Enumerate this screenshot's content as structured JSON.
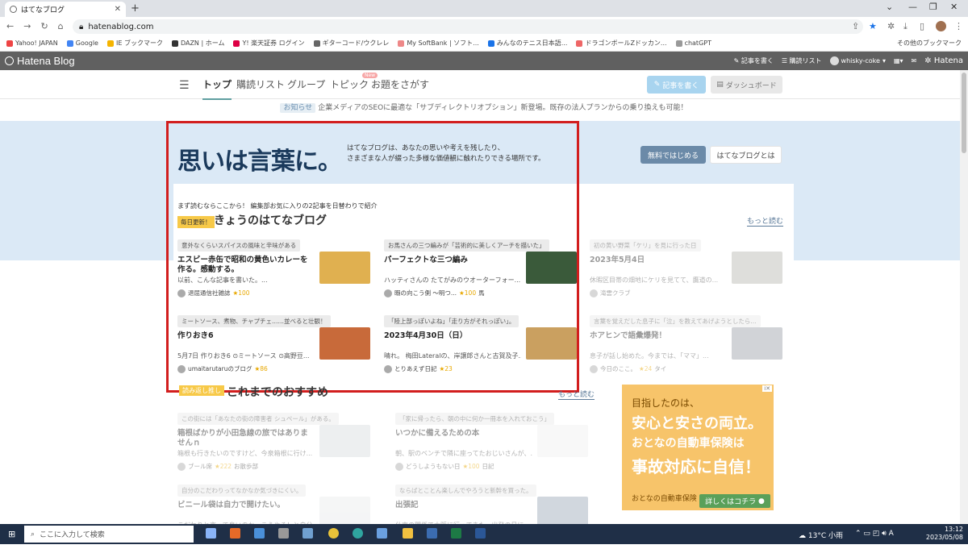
{
  "browser": {
    "tab_title": "はてなブログ",
    "address": "hatenablog.com",
    "other_bookmarks": "その他のブックマーク",
    "bookmarks": [
      "Yahoo! JAPAN",
      "Google",
      "IE ブックマーク",
      "DAZN | ホーム",
      "Y! 楽天証券 ログイン",
      "ギターコード/ウクレレ",
      "My SoftBank | ソフト...",
      "みんなのテニス日本語...",
      "ドラゴンボールZドッカン...",
      "chatGPT"
    ]
  },
  "hatena_bar": {
    "logo": "Hatena Blog",
    "write": "記事を書く",
    "reading": "購読リスト",
    "user": "whisky-coke",
    "brand": "Hatena"
  },
  "nav": {
    "items": [
      "トップ",
      "購読リスト",
      "グループ",
      "トピック",
      "お題をさがす"
    ],
    "new_badge": "New",
    "write_button": "記事を書く",
    "dashboard_button": "ダッシュボード"
  },
  "announcement": {
    "tag": "お知らせ",
    "text": "企業メディアのSEOに最適な「サブディレクトリオプション」新登場。既存の法人プランからの乗り換えも可能！"
  },
  "hero": {
    "title": "思いは言葉に。",
    "desc_line1": "はてなブログは、あなたの思いや考えを残したり、",
    "desc_line2": "さまざまな人が綴った多様な価値観に触れたりできる場所です。",
    "start_button": "無料ではじめる",
    "about_button": "はてなブログとは"
  },
  "daily": {
    "intro": "まず読むならここから！ 編集部お気に入りの2記事を日替わりで紹介",
    "badge": "毎日更新！",
    "title": "きょうのはてなブログ",
    "more": "もっと読む",
    "cards": [
      {
        "tag": "意外なくらいスパイスの風味と辛味がある",
        "title": "エスビー赤缶で昭和の黄色いカレーを作る。感動する。",
        "summary": "以前、こんな記事を書いた。...",
        "author": "退屈通信社雑誌",
        "stars": "★100",
        "star_value": 100
      },
      {
        "tag": "お馬さんの三つ編みが「芸術的に美しくアーチを描いた」",
        "title": "パーフェクトな三つ編み",
        "summary": "ハッティさんの たてがみのウオーターフォー...",
        "author": "暇の向こう側 〜明つ...",
        "stars": "★100",
        "extra": "馬",
        "star_value": 100
      },
      {
        "tag": "初の黄い野菜「ケリ」を見に行った日",
        "title": "2023年5月4日",
        "summary": "休暇区目帯の畑地にケリを見てて、鷹道の...",
        "author": "滝雲クラブ",
        "stars": "",
        "star_value": 0
      },
      {
        "tag": "ミートソース、煮物、チャプチェ……並べると壮観！",
        "title": "作りおき6",
        "summary": "5月7日 作りおき6 ⊙ミートソース ⊙高野豆...",
        "author": "umaitarutaruのブログ",
        "stars": "★86",
        "star_value": 86
      },
      {
        "tag": "「陸上部っぽいよね」「走り方がそれっぽい」。",
        "title": "2023年4月30日（日）",
        "summary": "晴れ。 梅田Lateralの、岸譲郎さんと古賀及子...",
        "author": "とりあえず日記",
        "stars": "★23",
        "star_value": 23
      },
      {
        "tag": "言葉を覚えだした息子に「泣」を教えてあげようとしたら...",
        "title": "ホアヒンで語彙爆発！",
        "summary": "息子が話し始めた。今までは、「ママ」...",
        "author": "今日のここ。",
        "stars": "★24",
        "extra": "タイ",
        "star_value": 24
      }
    ]
  },
  "recommend": {
    "badge": "読み返し推し",
    "title": "これまでのおすすめ",
    "more": "もっと読む",
    "cards": [
      {
        "tag": "この街には「あなたの街の障害者 シュペール」がある。",
        "title": "箱根ばかりが小田急線の旅ではありませんｎ",
        "summary": "箱根も行きたいのですけど、今泉箱根に行け...",
        "author": "ブール席",
        "stars": "★222",
        "extra": "お散歩部",
        "star_value": 222
      },
      {
        "tag": "「家に帰ったら、朝の中に何か一冊本を入れておこう」",
        "title": "いつかに備えるための本",
        "summary": "朝、駅のベンチで隣に座ってたおじいさんが、...",
        "author": "どうしようもない日",
        "stars": "★100",
        "extra": "日記",
        "star_value": 100
      },
      {
        "tag": "自分のこだわりってなかなか気づきにくい。",
        "title": "ビニール袋は自力で開けたい。",
        "summary": "こだわりと言って良いのか、こうやる！と自分...",
        "author": "",
        "stars": "",
        "star_value": 0
      },
      {
        "tag": "ならばとことん楽しんでやろうと新幹を買った。",
        "title": "出張記",
        "summary": "仕事の関係で大阪に行ってきた。出発の日に...",
        "author": "",
        "stars": "",
        "star_value": 0
      }
    ]
  },
  "ad": {
    "line1": "目指したのは、",
    "line2": "安心と安さの両立。",
    "line3": "おとなの自動車保険は",
    "line4": "事故対応に自信！",
    "brand": "おとなの自動車保険",
    "cta": "詳しくはコチラ"
  },
  "taskbar": {
    "search_placeholder": "ここに入力して検索",
    "weather": "13°C 小雨",
    "time": "13:12",
    "date": "2023/05/08"
  },
  "colors": {
    "accent": "#d21e1e",
    "hero_bg": "#dbe9f6",
    "hatena_bar": "#606060",
    "star": "#e8a800"
  }
}
